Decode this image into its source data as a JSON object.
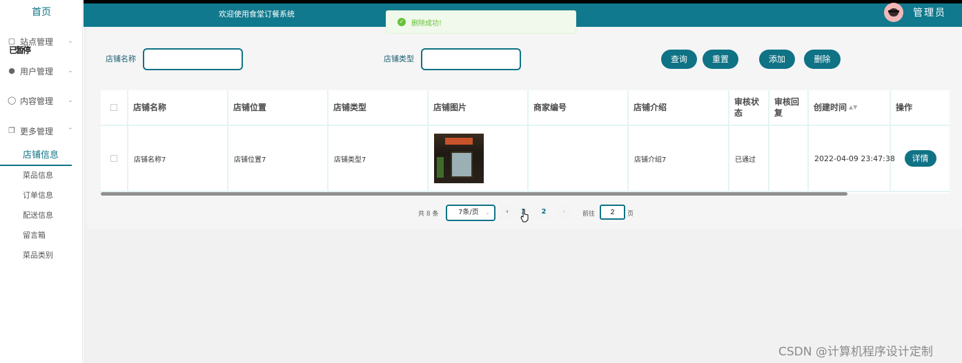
{
  "sidebar": {
    "home": "首页",
    "overlap_text": "已暂停",
    "menu": [
      {
        "label": "站点管理",
        "icon": "monitor-icon"
      },
      {
        "label": "用户管理",
        "icon": "user-icon"
      },
      {
        "label": "内容管理",
        "icon": "chat-icon"
      },
      {
        "label": "更多管理",
        "icon": "copy-icon"
      }
    ],
    "submenu": [
      {
        "label": "店铺信息",
        "active": true
      },
      {
        "label": "菜品信息"
      },
      {
        "label": "订单信息"
      },
      {
        "label": "配送信息"
      },
      {
        "label": "留言箱"
      },
      {
        "label": "菜品类别"
      }
    ]
  },
  "header": {
    "welcome": "欢迎使用食堂订餐系统",
    "admin": "管理员"
  },
  "toast": {
    "message": "删除成功!"
  },
  "search": {
    "name_label": "店铺名称",
    "name_value": "",
    "type_label": "店铺类型",
    "type_value": ""
  },
  "buttons": {
    "query": "查询",
    "reset": "重置",
    "add": "添加",
    "delete": "删除"
  },
  "table": {
    "headers": [
      "店铺名称",
      "店铺位置",
      "店铺类型",
      "店铺图片",
      "商家编号",
      "店铺介绍",
      "审核状态",
      "审核回复",
      "创建时间",
      "操作"
    ],
    "rows": [
      {
        "name": "店铺名称7",
        "location": "店铺位置7",
        "type": "店铺类型7",
        "merchant_no": "",
        "intro": "店铺介绍7",
        "status": "已通过",
        "reply": "",
        "created": "2022-04-09 23:47:38",
        "action": "详情"
      }
    ]
  },
  "pagination": {
    "total": "共 8 条",
    "page_size": "7条/页",
    "pages": [
      "1",
      "2"
    ],
    "current_page": "1",
    "goto_prefix": "前往",
    "goto_value": "2",
    "goto_suffix": "页"
  },
  "watermark": "CSDN @计算机程序设计定制",
  "colors": {
    "accent": "#0f7285",
    "topbar": "#10798d",
    "success": "#67c23a"
  }
}
